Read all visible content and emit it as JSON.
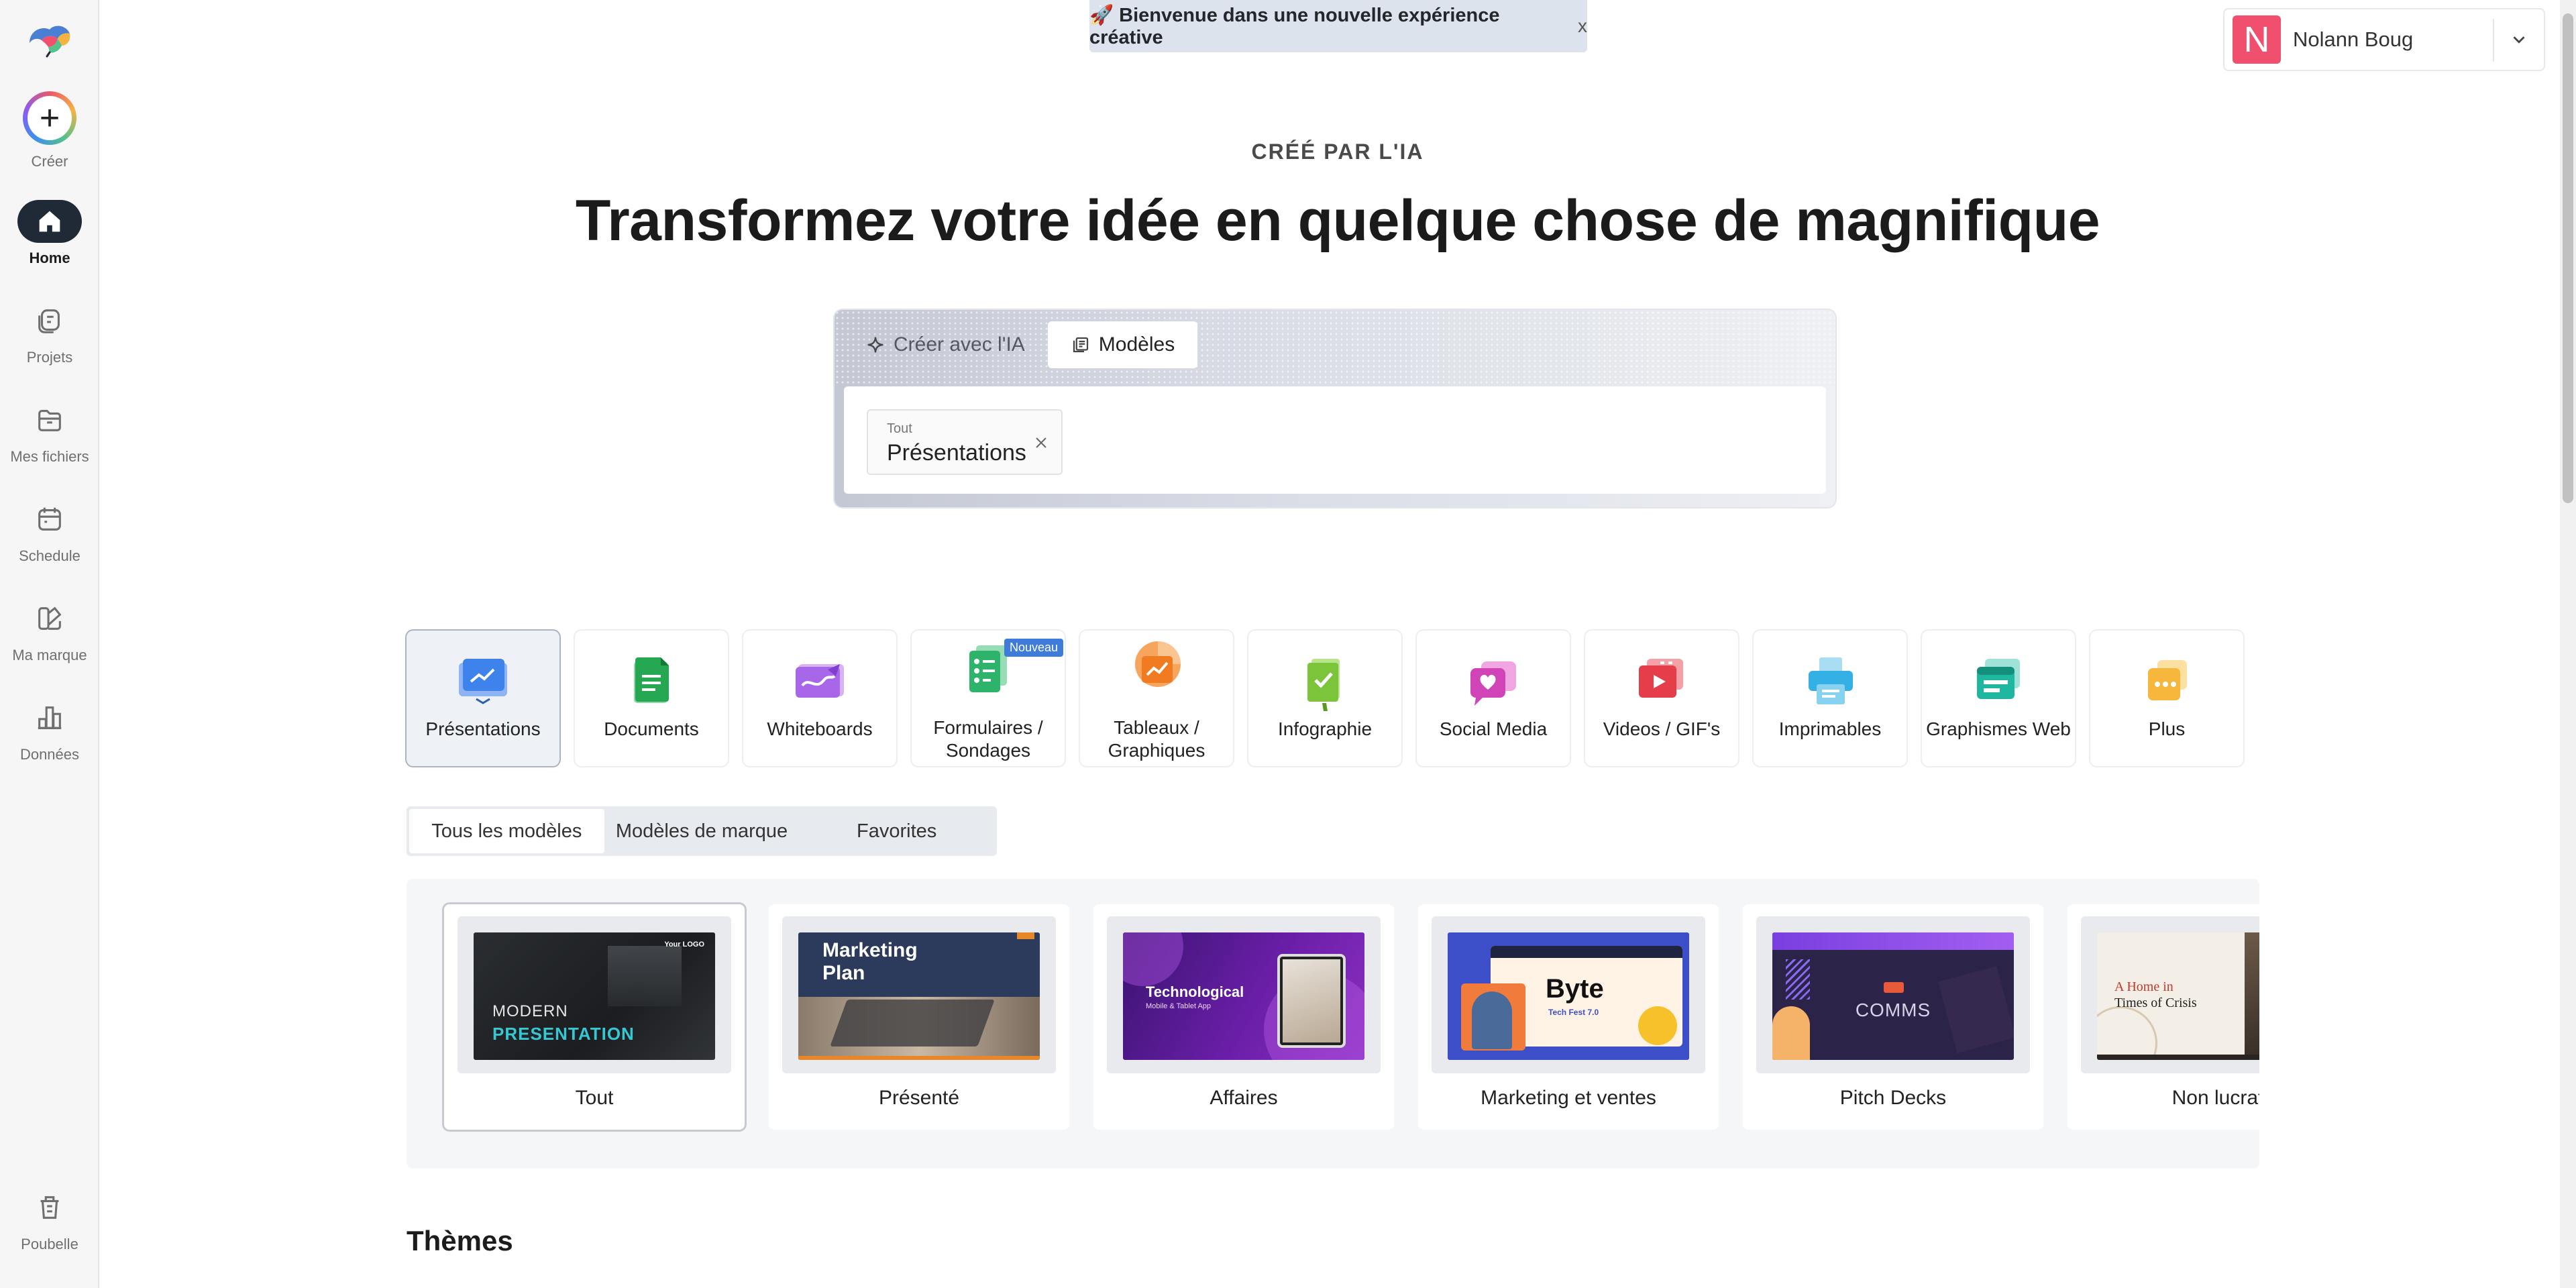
{
  "banner": {
    "text": "🚀 Bienvenue dans une nouvelle expérience créative",
    "close": "x"
  },
  "user": {
    "initial": "N",
    "name": "Nolann Boug"
  },
  "sidebar": {
    "create_label": "Créer",
    "items": [
      {
        "label": "Home",
        "icon": "home-icon",
        "active": true
      },
      {
        "label": "Projets",
        "icon": "projects-icon"
      },
      {
        "label": "Mes fichiers",
        "icon": "folder-icon"
      },
      {
        "label": "Schedule",
        "icon": "calendar-icon"
      },
      {
        "label": "Ma marque",
        "icon": "brand-icon"
      },
      {
        "label": "Données",
        "icon": "data-icon"
      }
    ],
    "trash_label": "Poubelle"
  },
  "hero": {
    "eyebrow": "CRÉÉ PAR L'IA",
    "title": "Transformez votre idée en quelque chose de magnifique"
  },
  "ai_box": {
    "tabs": [
      {
        "label": "Créer avec l'IA",
        "icon": "sparkle-icon"
      },
      {
        "label": "Modèles",
        "icon": "templates-icon",
        "active": true
      }
    ],
    "chip": {
      "small": "Tout",
      "main": "Présentations"
    }
  },
  "categories": [
    {
      "label": "Présentations",
      "active": true
    },
    {
      "label": "Documents"
    },
    {
      "label": "Whiteboards"
    },
    {
      "label": "Formulaires / Sondages",
      "badge": "Nouveau"
    },
    {
      "label": "Tableaux / Graphiques"
    },
    {
      "label": "Infographie"
    },
    {
      "label": "Social Media"
    },
    {
      "label": "Videos / GIF's"
    },
    {
      "label": "Imprimables"
    },
    {
      "label": "Graphismes Web"
    },
    {
      "label": "Plus"
    }
  ],
  "template_tabs": [
    {
      "label": "Tous les modèles",
      "active": true
    },
    {
      "label": "Modèles de marque"
    },
    {
      "label": "Favorites"
    }
  ],
  "templates": [
    {
      "label": "Tout",
      "thumb": {
        "line1": "MODERN",
        "line2": "PRESENTATION",
        "corner": "Your LOGO"
      },
      "active": true
    },
    {
      "label": "Présenté",
      "thumb": {
        "line1": "Marketing",
        "line2": "Plan"
      }
    },
    {
      "label": "Affaires",
      "thumb": {
        "line1": "Technological",
        "line2": "Mobile & Tablet App"
      }
    },
    {
      "label": "Marketing et ventes",
      "thumb": {
        "line1": "Byte",
        "line2": "Tech Fest 7.0"
      }
    },
    {
      "label": "Pitch Decks",
      "thumb": {
        "line1": "COMMS"
      }
    },
    {
      "label": "Non lucrat",
      "thumb": {
        "line1": "A Home in",
        "line2": "Times of Crisis"
      }
    }
  ],
  "sections": {
    "themes": "Thèmes"
  }
}
